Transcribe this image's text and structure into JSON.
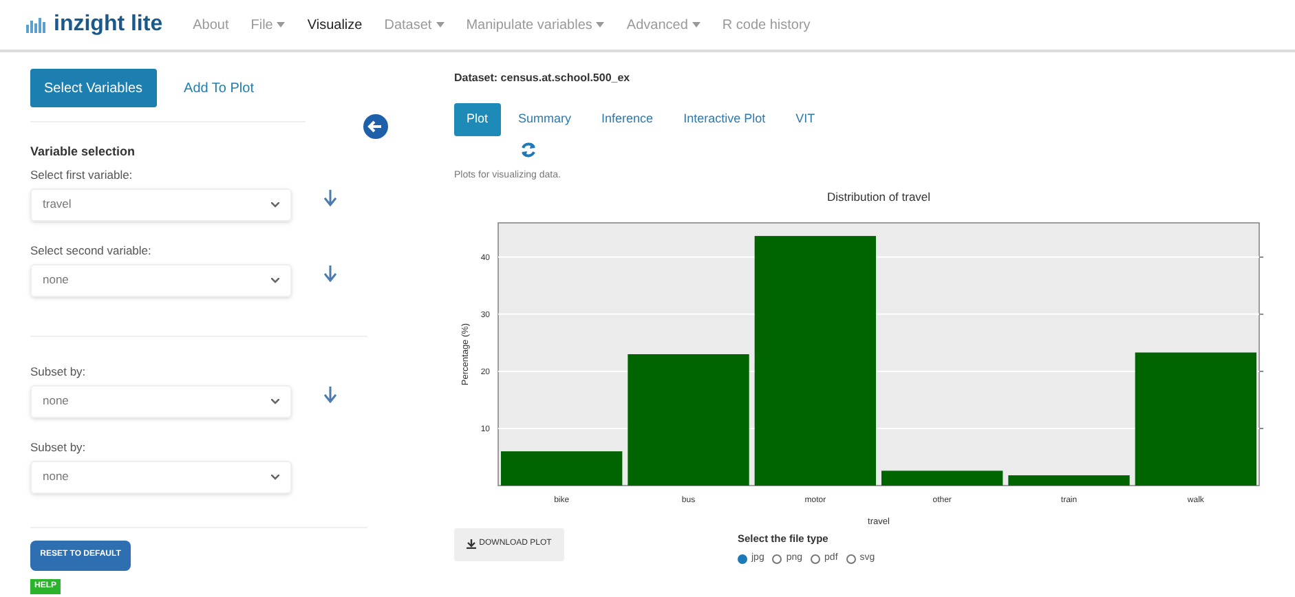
{
  "navbar": {
    "logo": "inzight lite",
    "items": [
      {
        "label": "About",
        "dropdown": false,
        "selected": false
      },
      {
        "label": "File",
        "dropdown": true,
        "selected": false
      },
      {
        "label": "Visualize",
        "dropdown": false,
        "selected": true
      },
      {
        "label": "Dataset",
        "dropdown": true,
        "selected": false
      },
      {
        "label": "Manipulate variables",
        "dropdown": true,
        "selected": false
      },
      {
        "label": "Advanced",
        "dropdown": true,
        "selected": false
      },
      {
        "label": "R code history",
        "dropdown": false,
        "selected": false
      }
    ]
  },
  "sidebar": {
    "tabs": [
      {
        "label": "Select Variables",
        "selected": true
      },
      {
        "label": "Add To Plot",
        "selected": false
      }
    ],
    "heading": "Variable selection",
    "groups": [
      {
        "fields": [
          {
            "label": "Select first variable:",
            "value": "travel",
            "has_arrow": true
          },
          {
            "label": "Select second variable:",
            "value": "none",
            "has_arrow": true
          }
        ]
      },
      {
        "fields": [
          {
            "label": "Subset by:",
            "value": "none",
            "has_arrow": true
          },
          {
            "label": "Subset by:",
            "value": "none",
            "has_arrow": false
          }
        ]
      }
    ],
    "reset_button": "RESET TO DEFAULT",
    "help_badge": "HELP"
  },
  "main": {
    "dataset": "Dataset: census.at.school.500_ex",
    "tabs": [
      {
        "label": "Plot",
        "selected": true
      },
      {
        "label": "Summary",
        "selected": false
      },
      {
        "label": "Inference",
        "selected": false
      },
      {
        "label": "Interactive Plot",
        "selected": false
      },
      {
        "label": "VIT",
        "selected": false
      }
    ],
    "description": "Plots for visualizing data.",
    "chart_data": {
      "type": "bar",
      "title": "Distribution of travel",
      "xlabel": "travel",
      "ylabel": "Percentage (%)",
      "categories": [
        "bike",
        "bus",
        "motor",
        "other",
        "train",
        "walk"
      ],
      "series": [
        {
          "color": "#006400",
          "values": [
            6,
            23,
            43.7,
            2.6,
            1.8,
            23.3
          ]
        }
      ],
      "grid": true,
      "ylim": [
        0,
        46
      ],
      "yticks": [
        10,
        20,
        30,
        40
      ]
    },
    "download_button": "DOWNLOAD PLOT",
    "file_type_label": "Select the file type",
    "file_types": [
      {
        "label": "jpg",
        "selected": true
      },
      {
        "label": "png",
        "selected": false
      },
      {
        "label": "pdf",
        "selected": false
      },
      {
        "label": "svg",
        "selected": false
      }
    ]
  }
}
